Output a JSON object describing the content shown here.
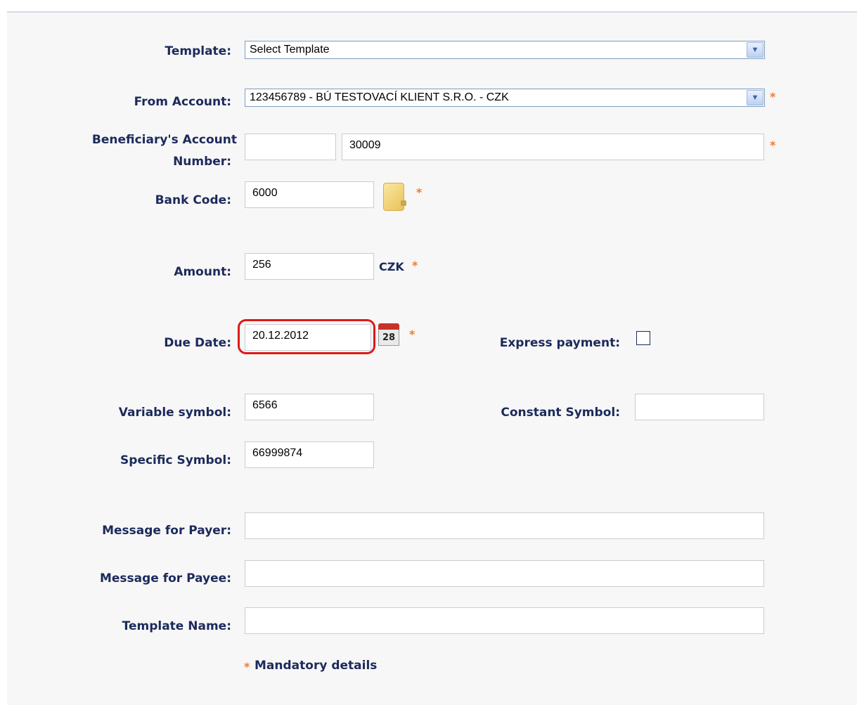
{
  "form": {
    "template": {
      "label": "Template:",
      "selected": "Select Template"
    },
    "from_account": {
      "label": "From Account:",
      "selected": "123456789 - BÚ TESTOVACÍ KLIENT S.R.O. - CZK"
    },
    "beneficiary": {
      "label_line1": "Beneficiary's Account",
      "label_line2": "Number:",
      "prefix": "",
      "number": "30009"
    },
    "bank_code": {
      "label": "Bank Code:",
      "value": "6000"
    },
    "amount": {
      "label": "Amount:",
      "value": "256",
      "currency": "CZK"
    },
    "due_date": {
      "label": "Due Date:",
      "value": "20.12.2012",
      "calendar_day": "28"
    },
    "express_payment": {
      "label": "Express payment:",
      "checked": false
    },
    "variable_symbol": {
      "label": "Variable symbol:",
      "value": "6566"
    },
    "constant_symbol": {
      "label": "Constant Symbol:",
      "value": ""
    },
    "specific_symbol": {
      "label": "Specific Symbol:",
      "value": "66999874"
    },
    "message_payer": {
      "label": "Message for Payer:",
      "value": ""
    },
    "message_payee": {
      "label": "Message for Payee:",
      "value": ""
    },
    "template_name": {
      "label": "Template Name:",
      "value": ""
    },
    "mandatory_star": "*",
    "mandatory_note": "Mandatory details"
  },
  "colors": {
    "label": "#1c2a5b",
    "required_star": "#f07a30",
    "highlight": "#e01818"
  },
  "icons": {
    "select_arrow": "chevron-down-icon",
    "bank_lookup": "folder-icon",
    "calendar": "calendar-icon"
  }
}
